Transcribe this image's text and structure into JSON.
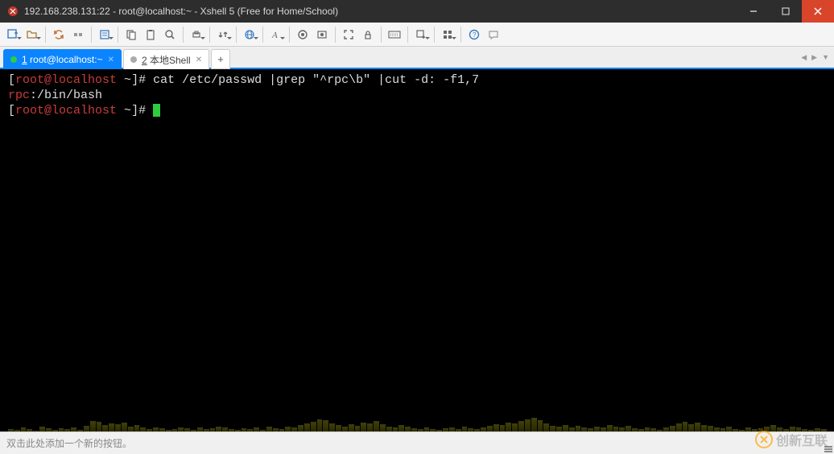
{
  "window": {
    "title": "192.168.238.131:22 - root@localhost:~ - Xshell 5 (Free for Home/School)"
  },
  "tabs": {
    "active": {
      "label": "1 root@localhost:~",
      "underline": "1"
    },
    "inactive": {
      "label": "2 本地Shell",
      "underline": "2"
    }
  },
  "terminal": {
    "line1_prompt_open": "[",
    "line1_user": "root@localhost",
    "line1_tilde": " ~",
    "line1_close": "]# ",
    "line1_cmd": "cat /etc/passwd |grep \"^rpc\\b\" |cut -d: -f1,7",
    "line2": "rpc",
    "line2_rest": ":/bin/bash",
    "line3_prompt_open": "[",
    "line3_user": "root@localhost",
    "line3_tilde": " ~",
    "line3_close": "]# "
  },
  "status": {
    "text": "双击此处添加一个新的按钮。"
  },
  "watermark": {
    "text": "创新互联"
  }
}
